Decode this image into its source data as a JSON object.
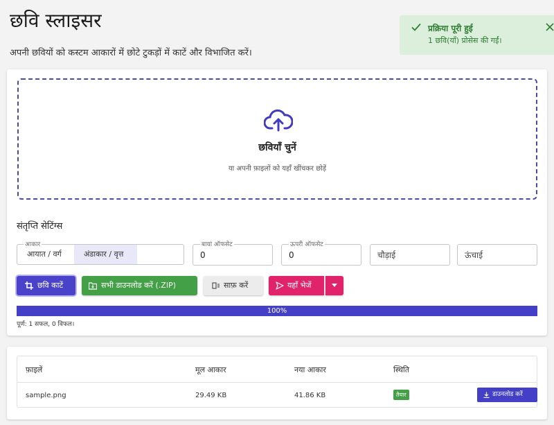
{
  "header": {
    "title": "छवि स्लाइसर",
    "subtitle": "अपनी छवियों को कस्टम आकारों में छोटे टुकड़ों में काटें और विभाजित करें।"
  },
  "toast": {
    "title": "प्रक्रिया पूरी हुई",
    "message": "1 छवि(याँ) प्रोसेस की गईं।",
    "color": "#2e7d32",
    "icons": [
      "check-icon",
      "close-icon"
    ]
  },
  "dropzone": {
    "title": "छवियाँ चुनें",
    "subtitle": "या अपनी फ़ाइलों को यहाँ खींचकर छोड़ें",
    "icon": "cloud-upload-icon"
  },
  "settings": {
    "label": "संतृप्ति सेटिंग्स",
    "shape_label": "आकार",
    "shape_options": [
      "आयात / वर्ग",
      "अंडाकार / वृत्त"
    ],
    "shape_selected": "अंडाकार / वृत्त",
    "left_offset_label": "बायां ऑफसेट",
    "left_offset_value": "0",
    "top_offset_label": "ऊपरी ऑफसेट",
    "top_offset_value": "0",
    "width_placeholder": "चौड़ाई",
    "height_placeholder": "ऊंचाई"
  },
  "actions": {
    "crop": "छवि काटें",
    "download_zip": "सभी डाउनलोड करें (.ZIP)",
    "clear": "साफ़ करें",
    "send": "यहाँ भेजें"
  },
  "progress": {
    "value": 1.0,
    "text": "100%",
    "status": "पूर्ण: 1 सफल, 0 विफल।"
  },
  "table": {
    "headers": [
      "फ़ाइलें",
      "मूल आकार",
      "नया आकार",
      "स्थिति"
    ],
    "rows": [
      {
        "file": "sample.png",
        "original_size": "29.49 KB",
        "new_size": "41.86 KB",
        "status": "तैयार",
        "download": "डाउनलोड करें"
      }
    ]
  },
  "colors": {
    "primary": "#4340c7",
    "success": "#43a047",
    "accent": "#e0236a"
  }
}
